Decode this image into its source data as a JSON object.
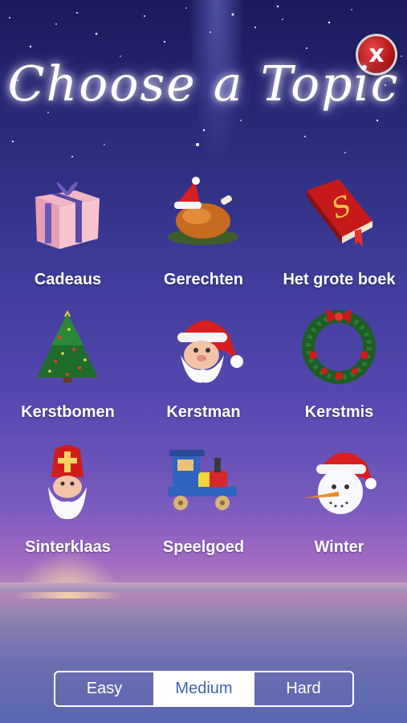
{
  "header": {
    "title": "Choose a Topic",
    "close_label": "x"
  },
  "topics": [
    {
      "label": "Cadeaus",
      "icon": "gift-icon"
    },
    {
      "label": "Gerechten",
      "icon": "roast-turkey-icon"
    },
    {
      "label": "Het grote boek",
      "icon": "red-book-icon"
    },
    {
      "label": "Kerstbomen",
      "icon": "christmas-tree-icon"
    },
    {
      "label": "Kerstman",
      "icon": "santa-icon"
    },
    {
      "label": "Kerstmis",
      "icon": "wreath-icon"
    },
    {
      "label": "Sinterklaas",
      "icon": "sinterklaas-icon"
    },
    {
      "label": "Speelgoed",
      "icon": "toy-train-icon"
    },
    {
      "label": "Winter",
      "icon": "snowman-icon"
    }
  ],
  "difficulty": {
    "options": [
      "Easy",
      "Medium",
      "Hard"
    ],
    "selected": "Medium"
  },
  "colors": {
    "accent": "#3e63b8",
    "close_red": "#c21c1c",
    "background_top": "#1b1a5c"
  }
}
